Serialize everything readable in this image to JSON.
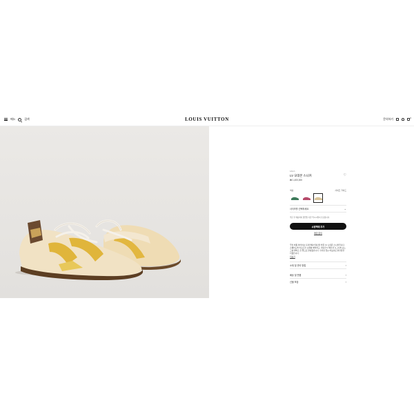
{
  "header": {
    "menu_label": "메뉴",
    "search_label": "검색",
    "logo": "LOUIS VUITTON",
    "contact_label": "문의하기",
    "bag_count": "0"
  },
  "product": {
    "breadcrumb": "1AHJ...",
    "title": "LV 오데온 스니커",
    "price": "₩ 1,400,000",
    "color_label": "색상",
    "size_guide": "사이즈 가이드",
    "swatches": [
      {
        "name": "green",
        "color": "#3d7a5a",
        "selected": false
      },
      {
        "name": "pink",
        "color": "#b64a6a",
        "selected": false
      },
      {
        "name": "beige",
        "color": "#d9c49a",
        "selected": true
      }
    ],
    "size_select": "사이즈를 선택하세요",
    "note": "주문 후 배송까지 영업일 기준 약 2~3일이 소요됩니다.",
    "cta": "쇼핑백에 추가",
    "store_link": "매장 문의",
    "description": "루이 비통 아카이브 디자인에서 영감을 받은 LV 오데온 스니커입니다. 스웨이드와 카프스킨 소재를 매치하고, 대담한 V 패턴과 시그니처 모노그램 캔버스 힐 탭으로 완성했습니다. 쿠션감 있는 아웃솔로 편안함을 더했습니다.",
    "more": "더보기",
    "rows": [
      "소재 및 관리 방법",
      "배송 및 반품",
      "선물 포장"
    ]
  },
  "colors": {
    "cta_bg": "#111111",
    "image_bg": "#e8e6e3"
  }
}
